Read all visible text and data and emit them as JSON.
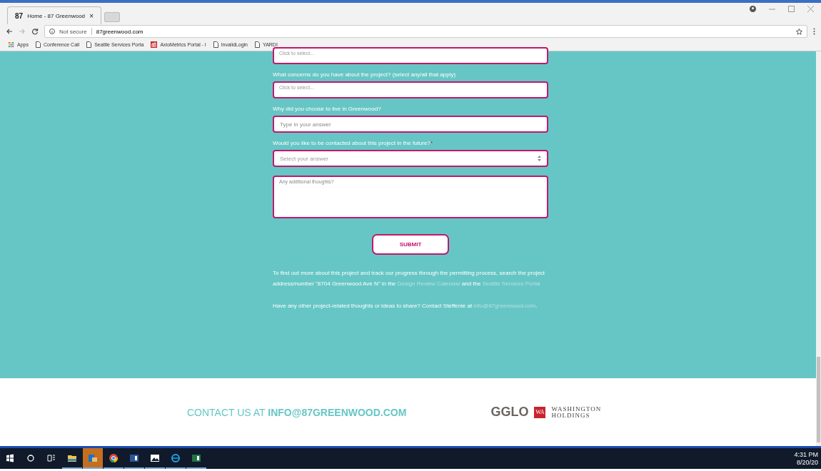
{
  "browser": {
    "tabs": [
      {
        "favicon": "87",
        "title": "Home - 87 Greenwood",
        "close": "×",
        "selected": true
      }
    ],
    "address": {
      "security": "Not secure",
      "url": "87greenwood.com"
    },
    "bookmarks": [
      {
        "kind": "apps",
        "label": "Apps"
      },
      {
        "kind": "page",
        "label": "Conference Call"
      },
      {
        "kind": "page",
        "label": "Seattle Services Porta"
      },
      {
        "kind": "red",
        "label": "AxioMetrics Portal - l"
      },
      {
        "kind": "page",
        "label": "InvalidLogin"
      },
      {
        "kind": "page",
        "label": "YARDI"
      }
    ]
  },
  "form": {
    "fields": [
      {
        "kind": "multiselect",
        "placeholder": "Click to select..."
      },
      {
        "kind": "multiselect",
        "label": "What concerns do you have about the project? (select any/all that apply)",
        "placeholder": "Click to select..."
      },
      {
        "kind": "text",
        "label": "Why did you choose to live in Greenwood?",
        "placeholder": "Type in your answer"
      },
      {
        "kind": "select",
        "label": "Would you like to be contacted about this project in the future?",
        "required_mark": "*",
        "placeholder": "Select your answer"
      },
      {
        "kind": "textarea",
        "placeholder": "Any additional thoughts?"
      }
    ],
    "submit": "SUBMIT",
    "paragraphs": [
      [
        {
          "kind": "text",
          "text": "To find out more about this project and track our progress through the permitting process, search the project address/number \"8704 Greenwood Ave N\" in the "
        },
        {
          "kind": "link",
          "text": "Design Review Calendar"
        },
        {
          "kind": "text",
          "text": " and the "
        },
        {
          "kind": "link",
          "text": "Seattle Services Portal"
        }
      ],
      [
        {
          "kind": "text",
          "text": "Have any other project-related thoughts or ideas to share? Contact Steffenie at "
        },
        {
          "kind": "link",
          "text": "info@87greenwood.com"
        },
        {
          "kind": "text",
          "text": "."
        }
      ]
    ]
  },
  "footer": {
    "contact": "CONTACT US AT **INFO@87GREENWOOD.COM**",
    "logo_gglo": "GGLO",
    "logo_wa_mark": "WA",
    "logo_wa_lines": [
      "WASHINGTON",
      "HOLDINGS"
    ]
  },
  "taskbar": {
    "items": [
      {
        "kind": "start",
        "open": false,
        "selected": false
      },
      {
        "kind": "search",
        "open": false,
        "selected": false
      },
      {
        "kind": "taskview",
        "open": false,
        "selected": false
      },
      {
        "kind": "folder",
        "open": true,
        "selected": false
      },
      {
        "kind": "outlook",
        "open": true,
        "selected": true
      },
      {
        "kind": "chrome",
        "open": true,
        "selected": false
      },
      {
        "kind": "word",
        "open": true,
        "selected": false
      },
      {
        "kind": "photos",
        "open": true,
        "selected": false
      },
      {
        "kind": "ie",
        "open": true,
        "selected": false
      },
      {
        "kind": "excel",
        "open": true,
        "selected": false
      }
    ],
    "time": "4:31 PM",
    "date": "8/20/20"
  }
}
